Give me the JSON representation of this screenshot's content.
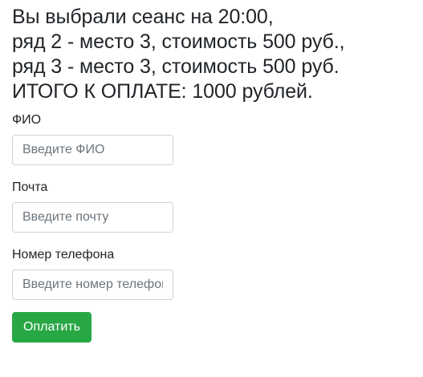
{
  "summary": {
    "line1": "Вы выбрали сеанс на 20:00,",
    "line2": "ряд 2 - место 3, стоимость 500 руб.,",
    "line3": "ряд 3 - место 3, стоимость 500 руб.",
    "line4": "ИТОГО К ОПЛАТЕ: 1000 рублей."
  },
  "form": {
    "fio": {
      "label": "ФИО",
      "placeholder": "Введите ФИО",
      "value": ""
    },
    "email": {
      "label": "Почта",
      "placeholder": "Введите почту",
      "value": ""
    },
    "phone": {
      "label": "Номер телефона",
      "placeholder": "Введите номер телефона",
      "value": ""
    },
    "submit_label": "Оплатить"
  },
  "colors": {
    "button_bg": "#28a745",
    "text": "#212529",
    "input_border": "#ced4da",
    "placeholder": "#6c757d"
  }
}
